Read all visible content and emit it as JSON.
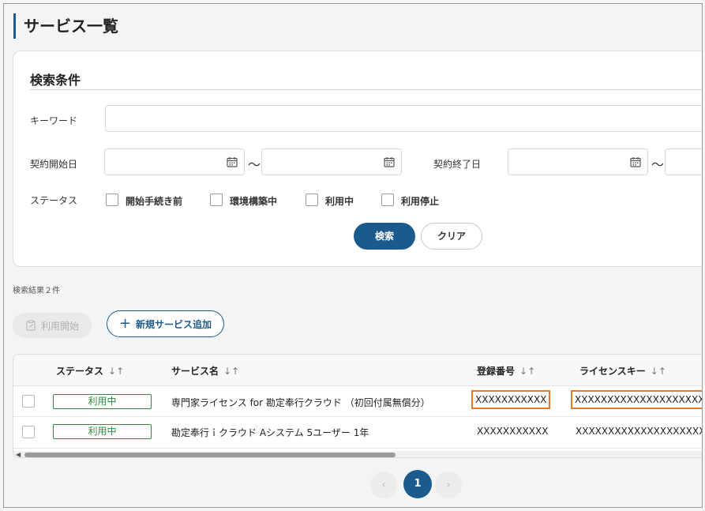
{
  "page": {
    "title": "サービス一覧"
  },
  "search": {
    "title": "検索条件",
    "keyword_label": "キーワード",
    "keyword_value": "",
    "start_date_label": "契約開始日",
    "end_date_label": "契約終了日",
    "range_separator": "～",
    "status_label": "ステータス",
    "status_options": [
      "開始手続き前",
      "環境構築中",
      "利用中",
      "利用停止"
    ],
    "search_button": "検索",
    "clear_button": "クリア"
  },
  "results": {
    "count_text": "検索結果２件",
    "start_button": "利用開始",
    "add_button": "新規サービス追加"
  },
  "table": {
    "columns": [
      "ステータス",
      "サービス名",
      "登録番号",
      "ライセンスキー"
    ],
    "sort_glyph": "↓↑",
    "rows": [
      {
        "status": "利用中",
        "service": "専門家ライセンス for 勘定奉行クラウド （初回付属無償分）",
        "reg_no": "XXXXXXXXXXX",
        "license": "XXXXXXXXXXXXXXXXXXXX"
      },
      {
        "status": "利用中",
        "service": "勘定奉行ｉクラウド Aシステム 5ユーザー 1年",
        "reg_no": "XXXXXXXXXXX",
        "license": "XXXXXXXXXXXXXXXXXXXX"
      }
    ]
  },
  "pagination": {
    "prev": "‹",
    "current": "1",
    "next": "›"
  },
  "colors": {
    "primary": "#1b5a8c",
    "status_green": "#2d8a3e",
    "highlight": "#e07b2a"
  },
  "icons": [
    "calendar-icon",
    "clipboard-icon",
    "plus-icon",
    "sort-icon",
    "chevron-left-icon",
    "chevron-right-icon"
  ]
}
